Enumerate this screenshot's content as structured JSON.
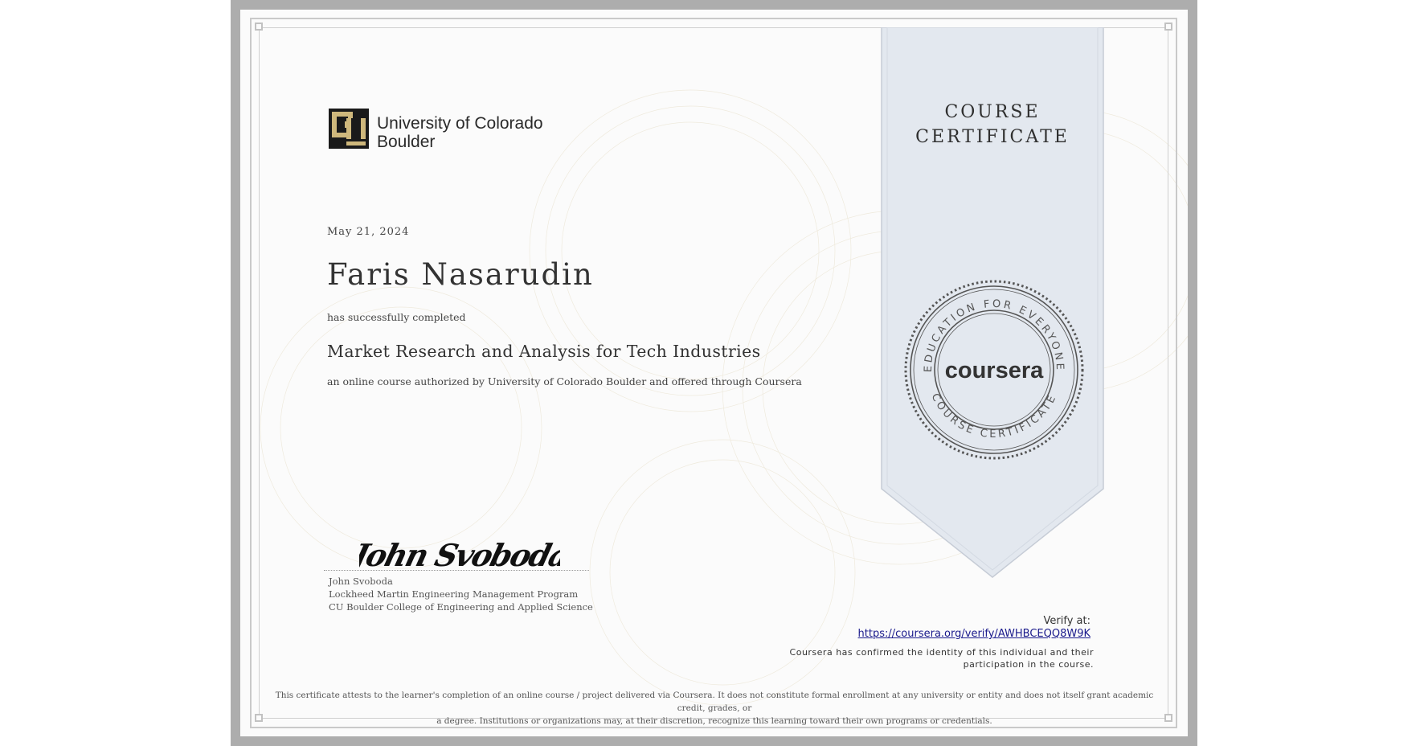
{
  "certificate": {
    "ribbon_line1": "COURSE",
    "ribbon_line2": "CERTIFICATE",
    "institution_line1": "University of Colorado",
    "institution_line2": "Boulder",
    "date": "May 21, 2024",
    "recipient": "Faris Nasarudin",
    "completed_text": "has successfully completed",
    "course_title": "Market Research and Analysis for Tech Industries",
    "authorized_text": "an online course authorized by University of Colorado Boulder and offered through Coursera",
    "signature_text": "John Svoboda",
    "signer_name": "John Svoboda",
    "signer_title": "Lockheed Martin Engineering Management Program",
    "signer_org": "CU Boulder College of Engineering and Applied Science",
    "verify_label": "Verify at:",
    "verify_url": "https://coursera.org/verify/AWHBCEQQ8W9K",
    "confirmed_line1": "Coursera has confirmed the identity of this individual and their",
    "confirmed_line2": "participation in the course.",
    "disclaimer_line1": "This certificate attests to the learner's completion of an online course / project delivered via Coursera. It does not constitute formal enrollment at any university or entity and does not itself grant academic credit, grades, or",
    "disclaimer_line2": "a degree. Institutions or organizations may, at their discretion, recognize this learning toward their own programs or credentials."
  },
  "seal": {
    "brand": "coursera",
    "top_arc": "EDUCATION FOR EVERYONE",
    "bottom_arc": "COURSE CERTIFICATE"
  },
  "icons": {
    "logo": "cu-boulder-logo-icon",
    "seal": "coursera-seal-icon"
  },
  "colors": {
    "ribbon": "#e3e8ef",
    "link": "#1a1a8c",
    "logo_gold": "#cfb87c"
  }
}
